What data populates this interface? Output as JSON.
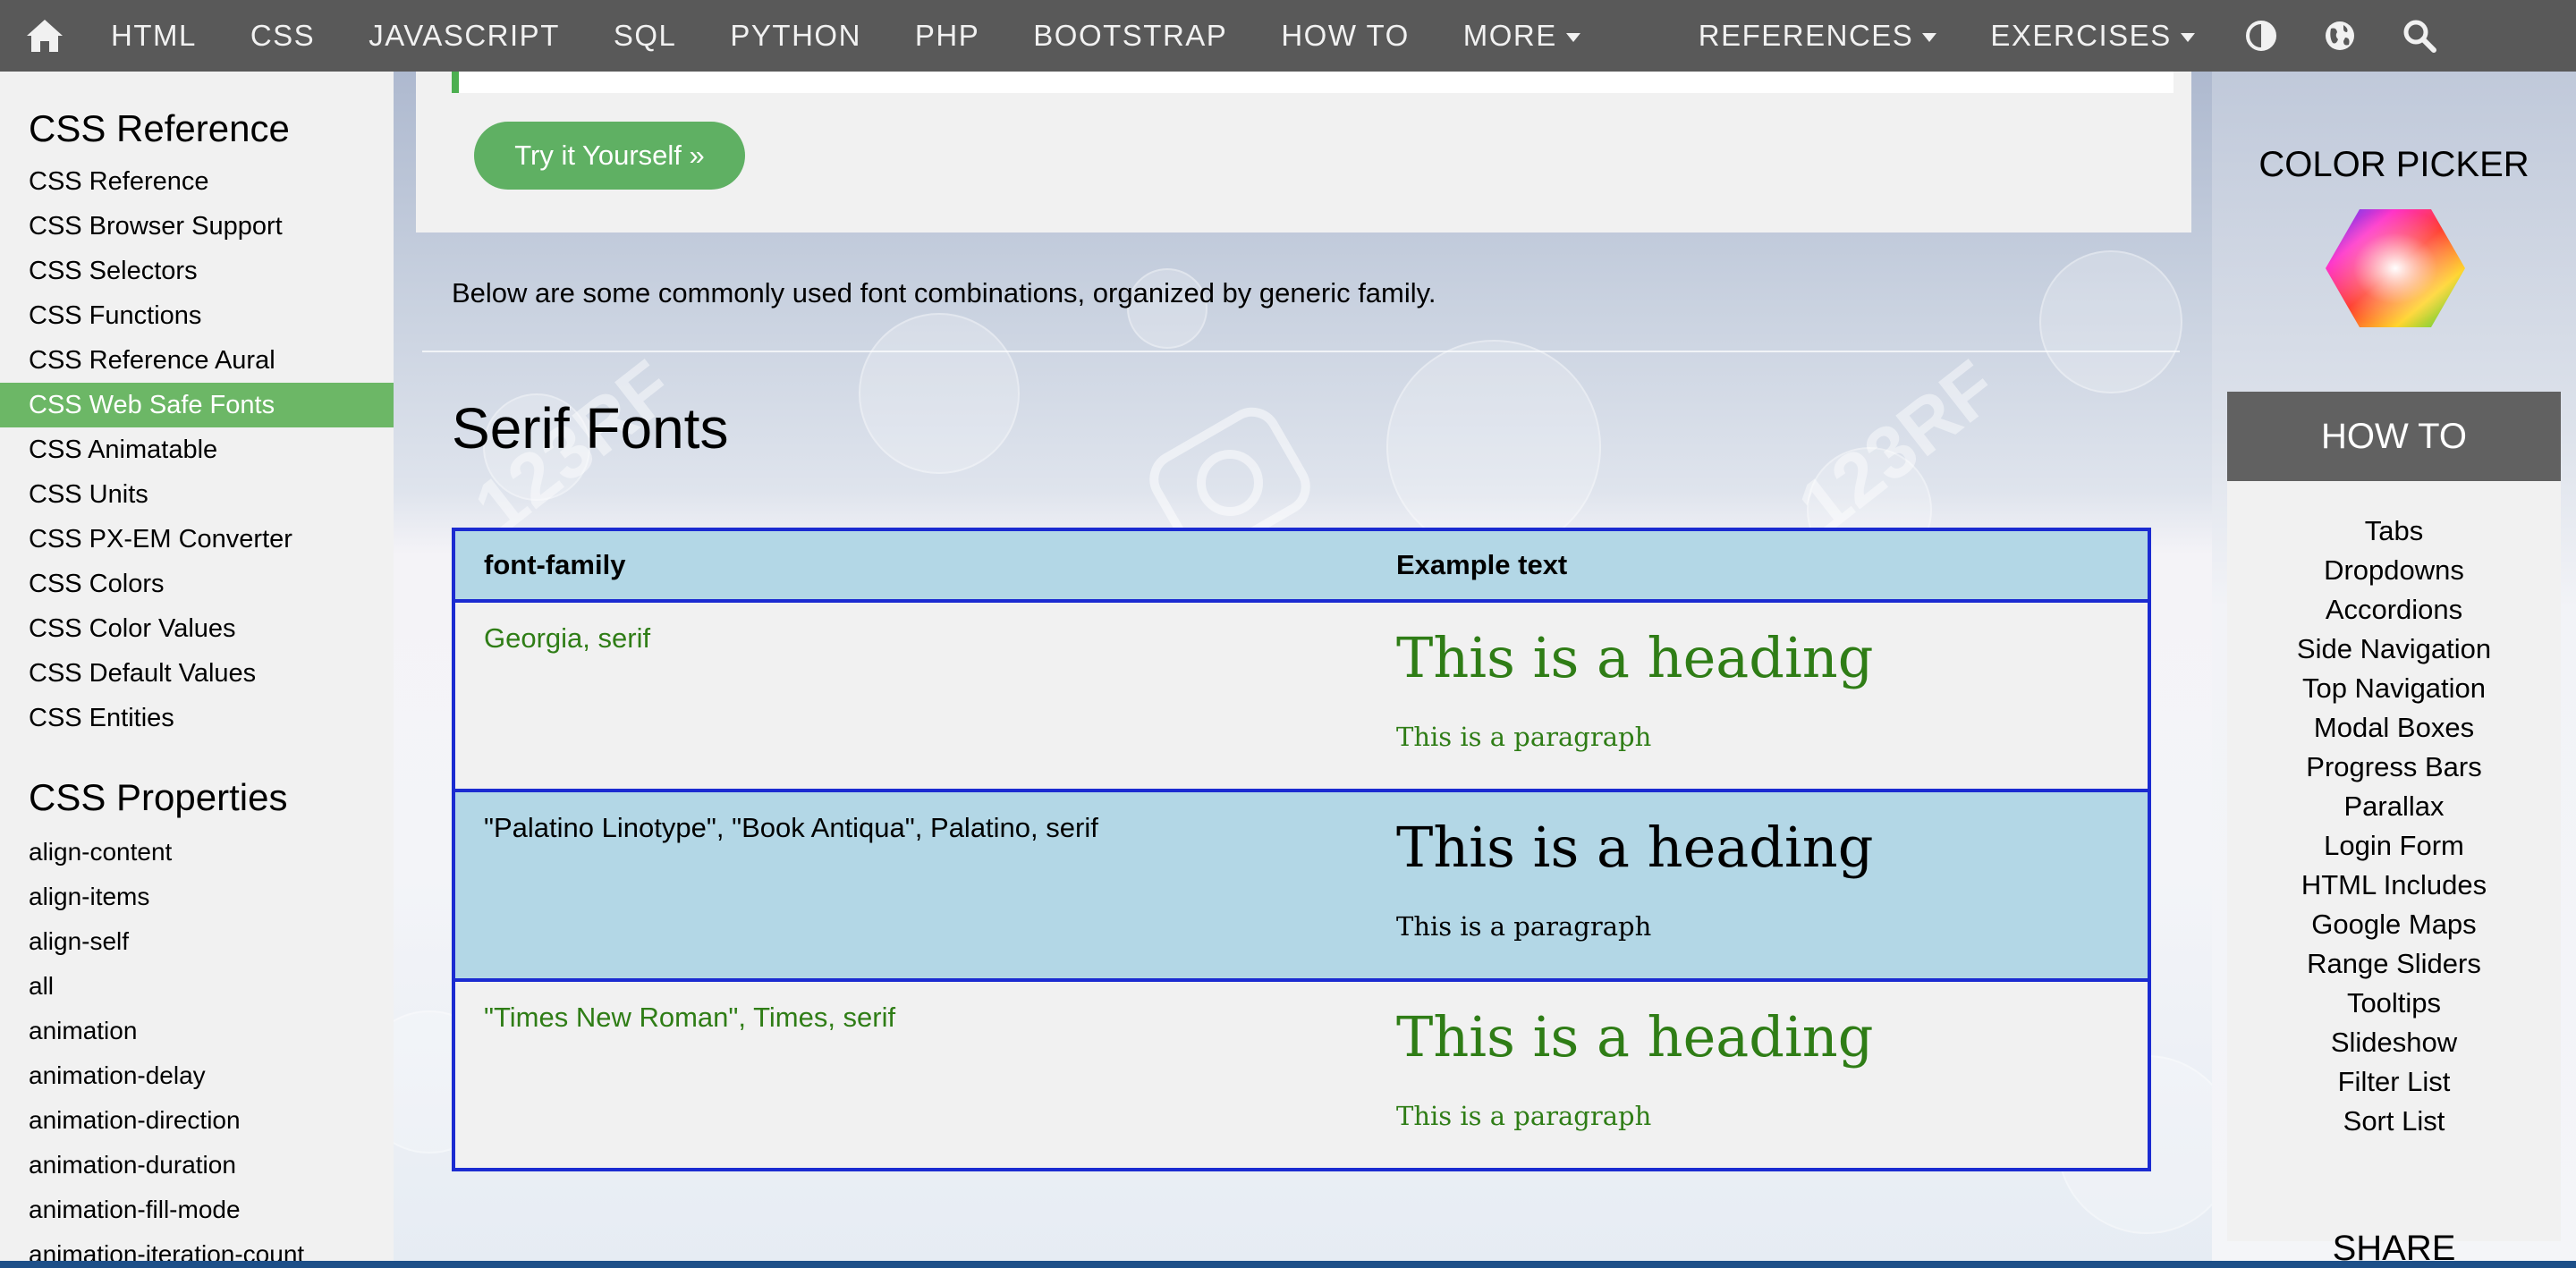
{
  "topnav": {
    "items": [
      {
        "label": "HTML"
      },
      {
        "label": "CSS"
      },
      {
        "label": "JAVASCRIPT"
      },
      {
        "label": "SQL"
      },
      {
        "label": "PYTHON"
      },
      {
        "label": "PHP"
      },
      {
        "label": "BOOTSTRAP"
      },
      {
        "label": "HOW TO"
      }
    ],
    "more": "MORE",
    "references": "REFERENCES",
    "exercises": "EXERCISES",
    "icons": [
      "home-icon",
      "contrast-icon",
      "globe-icon",
      "search-icon"
    ]
  },
  "sidebar": {
    "ref_title": "CSS Reference",
    "ref_links": [
      {
        "label": "CSS Reference"
      },
      {
        "label": "CSS Browser Support"
      },
      {
        "label": "CSS Selectors"
      },
      {
        "label": "CSS Functions"
      },
      {
        "label": "CSS Reference Aural"
      },
      {
        "label": "CSS Web Safe Fonts",
        "active": true
      },
      {
        "label": "CSS Animatable"
      },
      {
        "label": "CSS Units"
      },
      {
        "label": "CSS PX-EM Converter"
      },
      {
        "label": "CSS Colors"
      },
      {
        "label": "CSS Color Values"
      },
      {
        "label": "CSS Default Values"
      },
      {
        "label": "CSS Entities"
      }
    ],
    "props_title": "CSS Properties",
    "props": [
      {
        "label": "align-content"
      },
      {
        "label": "align-items"
      },
      {
        "label": "align-self"
      },
      {
        "label": "all"
      },
      {
        "label": "animation"
      },
      {
        "label": "animation-delay"
      },
      {
        "label": "animation-direction"
      },
      {
        "label": "animation-duration"
      },
      {
        "label": "animation-fill-mode"
      },
      {
        "label": "animation-iteration-count"
      }
    ]
  },
  "main": {
    "try_button": "Try it Yourself »",
    "intro": "Below are some commonly used font combinations, organized by generic family.",
    "section_title": "Serif Fonts",
    "table": {
      "headers": [
        "font-family",
        "Example text"
      ],
      "rows": [
        {
          "family": "Georgia, serif",
          "heading": "This is a heading",
          "paragraph": "This is a paragraph"
        },
        {
          "family": "\"Palatino Linotype\", \"Book Antiqua\", Palatino, serif",
          "heading": "This is a heading",
          "paragraph": "This is a paragraph"
        },
        {
          "family": "\"Times New Roman\", Times, serif",
          "heading": "This is a heading",
          "paragraph": "This is a paragraph"
        }
      ]
    }
  },
  "rightbar": {
    "color_picker_title": "COLOR PICKER",
    "howto_title": "HOW TO",
    "howto_links": [
      {
        "label": "Tabs"
      },
      {
        "label": "Dropdowns"
      },
      {
        "label": "Accordions"
      },
      {
        "label": "Side Navigation"
      },
      {
        "label": "Top Navigation"
      },
      {
        "label": "Modal Boxes"
      },
      {
        "label": "Progress Bars"
      },
      {
        "label": "Parallax"
      },
      {
        "label": "Login Form"
      },
      {
        "label": "HTML Includes"
      },
      {
        "label": "Google Maps"
      },
      {
        "label": "Range Sliders"
      },
      {
        "label": "Tooltips"
      },
      {
        "label": "Slideshow"
      },
      {
        "label": "Filter List"
      },
      {
        "label": "Sort List"
      }
    ],
    "share_title": "SHARE"
  },
  "colors": {
    "nav_bg": "#595959",
    "active_green": "#6cb766",
    "button_green": "#5fb063",
    "table_border": "#1b2bd1",
    "table_highlight": "#b3d7e6",
    "green_text": "#2f7d16",
    "howto_header": "#616161"
  }
}
